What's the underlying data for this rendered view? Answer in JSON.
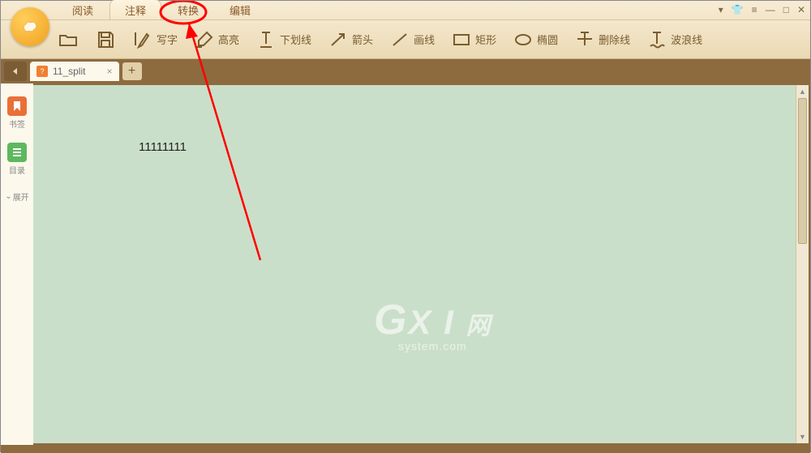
{
  "menu": {
    "tabs": [
      "阅读",
      "注释",
      "转换",
      "编辑"
    ]
  },
  "toolbar": {
    "write": "写字",
    "highlight": "高亮",
    "underline": "下划线",
    "arrow": "箭头",
    "drawline": "画线",
    "rect": "矩形",
    "ellipse": "椭圆",
    "strikethrough": "删除线",
    "wavyline": "波浪线"
  },
  "doc_tab": {
    "name": "11_split",
    "close": "×"
  },
  "sidebar": {
    "bookmark": "书签",
    "toc": "目录",
    "expand": "展开"
  },
  "document": {
    "text": "11111111"
  },
  "watermark": {
    "main": "GXI网",
    "sub": "system.com"
  }
}
